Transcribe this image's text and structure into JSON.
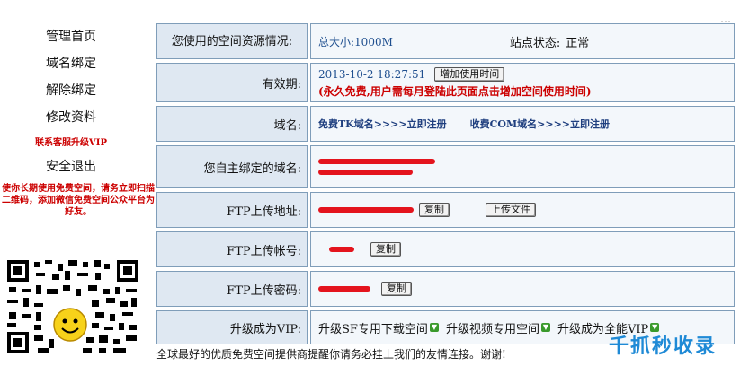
{
  "top_fragment": "…",
  "sidebar": {
    "items": [
      {
        "label": "管理首页"
      },
      {
        "label": "域名绑定"
      },
      {
        "label": "解除绑定"
      },
      {
        "label": "修改资料"
      }
    ],
    "vip_link": "联系客服升级VIP",
    "logout": "安全退出",
    "notice": "使你长期使用免费空间，请务立即扫描二维码，添加微信免费空间公众平台为好友。"
  },
  "usage": {
    "label": "您使用的空间资源情况:",
    "total_size": "总大小:1000M",
    "status_label": "站点状态:",
    "status_value": "正常"
  },
  "validity": {
    "label": "有效期:",
    "date": "2013-10-2 18:27:51",
    "add_time_button": "增加使用时间",
    "note": "(永久免费,用户需每月登陆此页面点击增加空间使用时间)"
  },
  "domain": {
    "label": "域名:",
    "link_tk": "免费TK域名>>>>立即注册",
    "link_com": "收费COM域名>>>>立即注册"
  },
  "bound_domain": {
    "label": "您自主绑定的域名:"
  },
  "ftp_address": {
    "label": "FTP上传地址:",
    "copy_button": "复制",
    "upload_button": "上传文件"
  },
  "ftp_account": {
    "label": "FTP上传帐号:",
    "copy_button": "复制"
  },
  "ftp_password": {
    "label": "FTP上传密码:",
    "copy_button": "复制"
  },
  "upgrade": {
    "label": "升级成为VIP:",
    "links": [
      "升级SF专用下载空间",
      "升级视频专用空间",
      "升级成为全能VIP"
    ]
  },
  "footer": "全球最好的优质免费空间提供商提醒你请务必挂上我们的友情连接。谢谢!",
  "watermark": "千抓秒收录"
}
